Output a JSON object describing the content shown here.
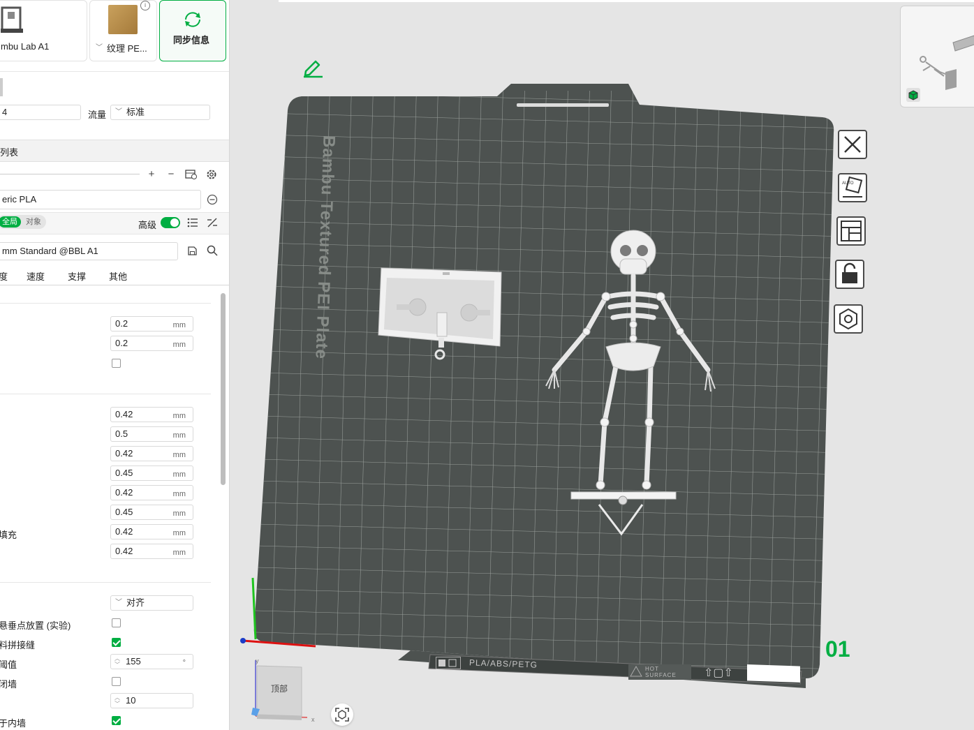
{
  "top_cards": {
    "printer_name": "mbu Lab A1",
    "plate_name": "纹理 PE...",
    "sync_label": "同步信息"
  },
  "filament_row": {
    "left_value": "4",
    "flow_label": "流量",
    "flow_value": "标准"
  },
  "list_header": "列表",
  "filament_profile": "eric PLA",
  "scope_tabs": {
    "global": "全局",
    "object": "对象"
  },
  "advanced_label": "高级",
  "process_profile": "mm Standard @BBL A1",
  "tabs": [
    "度",
    "速度",
    "支撑",
    "其他"
  ],
  "group1": [
    {
      "value": "0.2",
      "unit": "mm"
    },
    {
      "value": "0.2",
      "unit": "mm"
    }
  ],
  "group2": [
    {
      "value": "0.42",
      "unit": "mm"
    },
    {
      "value": "0.5",
      "unit": "mm"
    },
    {
      "value": "0.42",
      "unit": "mm"
    },
    {
      "value": "0.45",
      "unit": "mm"
    },
    {
      "value": "0.42",
      "unit": "mm"
    },
    {
      "value": "0.45",
      "unit": "mm"
    },
    {
      "value": "0.42",
      "unit": "mm"
    },
    {
      "value": "0.42",
      "unit": "mm"
    }
  ],
  "group2_fill_label": "填充",
  "group3": {
    "seam_value": "对齐",
    "overhang_label": "悬垂点放置 (实验)",
    "scarf_label": "料拼接缝",
    "threshold_label": "阈值",
    "threshold_value": "155",
    "threshold_unit": "°",
    "wall_label": "闭墙",
    "count_value": "10",
    "inner_wall_label": "于内墙"
  },
  "viewport": {
    "plate_text": "Bambu Textured PEI Plate",
    "plate_number": "01",
    "label_strip": "PLA/ABS/PETG",
    "hot_surface": "HOT SURFACE",
    "view_cube_label": "顶部",
    "axis_x": "x",
    "axis_y": "y"
  },
  "colors": {
    "accent": "#00ae42",
    "plate": "#4d5250",
    "grid": "#9aa09c"
  }
}
